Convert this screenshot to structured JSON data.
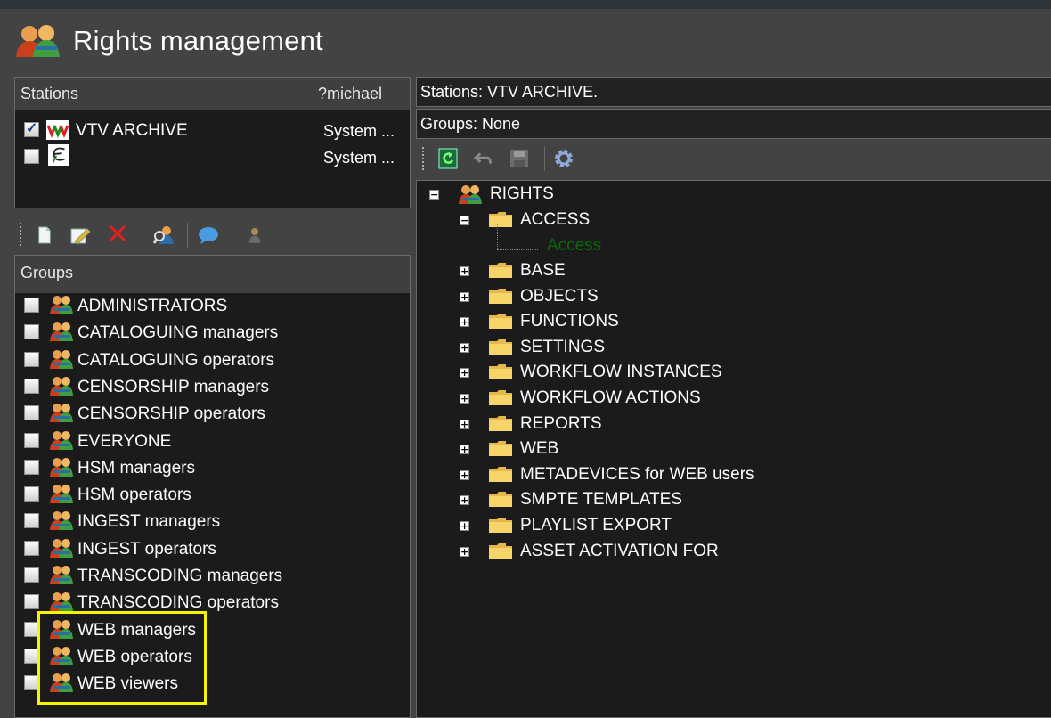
{
  "app": {
    "title": "Rights management"
  },
  "stations_panel": {
    "header_label": "Stations",
    "header_user": "?michael",
    "rows": [
      {
        "name": "VTV ARCHIVE",
        "type": "System ...",
        "checked": true,
        "logo": "vtv-logo-icon"
      },
      {
        "name": "",
        "type": "System ...",
        "checked": false,
        "logo": "e-logo-icon"
      }
    ]
  },
  "groups_toolbar": {
    "icons": [
      "new-document-icon",
      "edit-icon",
      "delete-icon",
      "search-user-icon",
      "message-icon",
      "user-icon"
    ]
  },
  "groups_panel": {
    "header_label": "Groups",
    "items": [
      {
        "label": "ADMINISTRATORS"
      },
      {
        "label": "CATALOGUING managers"
      },
      {
        "label": "CATALOGUING operators"
      },
      {
        "label": "CENSORSHIP managers"
      },
      {
        "label": "CENSORSHIP operators"
      },
      {
        "label": "EVERYONE"
      },
      {
        "label": "HSM managers"
      },
      {
        "label": "HSM operators"
      },
      {
        "label": "INGEST managers"
      },
      {
        "label": "INGEST operators"
      },
      {
        "label": "TRANSCODING managers"
      },
      {
        "label": "TRANSCODING operators"
      },
      {
        "label": "WEB managers"
      },
      {
        "label": "WEB operators"
      },
      {
        "label": "WEB viewers"
      }
    ]
  },
  "right_panel": {
    "stations_info": "Stations: VTV ARCHIVE.",
    "groups_info": "Groups: None",
    "toolbar_icons": [
      "refresh-icon",
      "undo-icon",
      "save-icon",
      "settings-gear-icon"
    ],
    "tree": {
      "root": "RIGHTS",
      "access": {
        "label": "ACCESS",
        "child": "Access"
      },
      "nodes": [
        {
          "label": "BASE"
        },
        {
          "label": "OBJECTS"
        },
        {
          "label": "FUNCTIONS"
        },
        {
          "label": "SETTINGS"
        },
        {
          "label": "WORKFLOW INSTANCES"
        },
        {
          "label": "WORKFLOW ACTIONS"
        },
        {
          "label": "REPORTS"
        },
        {
          "label": "WEB"
        },
        {
          "label": "METADEVICES for WEB users"
        },
        {
          "label": "SMPTE TEMPLATES"
        },
        {
          "label": "PLAYLIST EXPORT"
        },
        {
          "label": "ASSET ACTIVATION FOR"
        }
      ]
    }
  },
  "colors": {
    "background": "#434343",
    "panel": "#1b1b1b",
    "header": "#3f3f3f",
    "highlight": "#f5f500",
    "access_leaf": "#0a6a0a"
  }
}
